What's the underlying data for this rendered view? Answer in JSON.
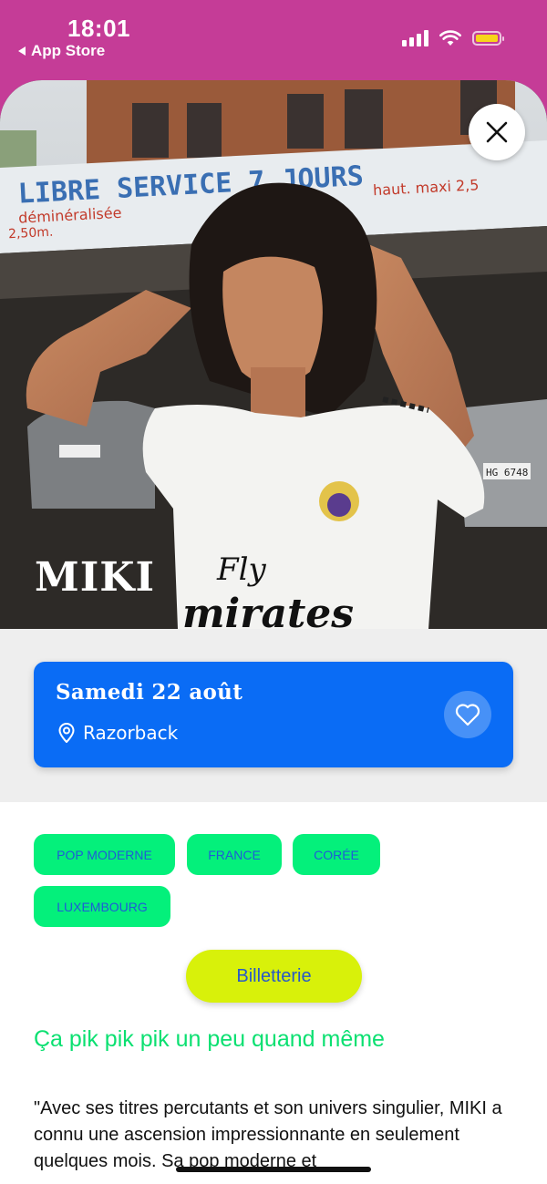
{
  "status_bar": {
    "time": "18:01",
    "back_label": "App Store",
    "signal_icon": "cellular-signal-icon",
    "wifi_icon": "wifi-icon",
    "battery_icon": "battery-icon",
    "battery_color": "#f7d51a",
    "background": "#c53c97"
  },
  "hero": {
    "artist_name": "MIKI",
    "close_icon": "close-icon",
    "photo_sign_line1": "LIBRE SERVICE 7 JOURS",
    "photo_sign_line2_left": "déminéralisée",
    "photo_sign_line2_right": "haut. maxi 2,5",
    "photo_sign_line3": "2,50m.",
    "photo_shirt_line1": "Fly",
    "photo_shirt_line2": "mirates",
    "photo_plate": "HG 6748"
  },
  "event": {
    "date": "Samedi 22 août",
    "venue": "Razorback",
    "location_icon": "location-pin-icon",
    "favorite_icon": "heart-icon",
    "card_color": "#0a6cf5"
  },
  "tags": [
    "POP MODERNE",
    "FRANCE",
    "CORÉE",
    "LUXEMBOURG"
  ],
  "ticket_button": "Billetterie",
  "subtitle": "Ça pik pik pik un peu quand même",
  "description": "\"Avec ses titres percutants et son univers singulier, MIKI a connu une ascension impressionnante en seulement quelques mois. Sa pop moderne et"
}
